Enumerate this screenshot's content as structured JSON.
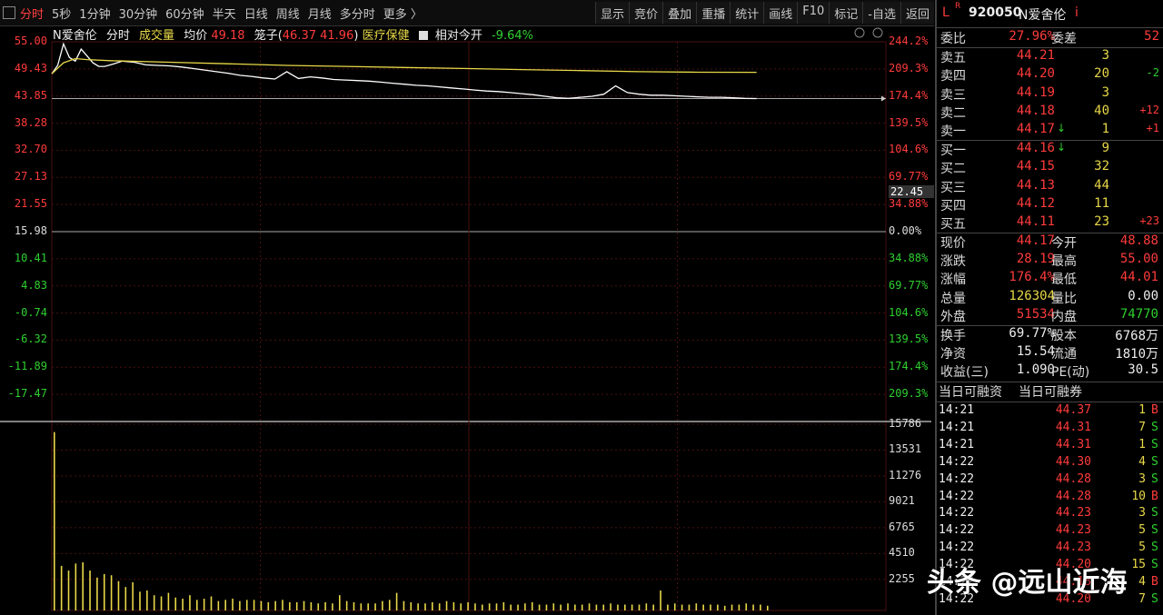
{
  "toolbar": {
    "periods": [
      "分时",
      "5秒",
      "1分钟",
      "30分钟",
      "60分钟",
      "半天",
      "日线",
      "周线",
      "月线",
      "多分时",
      "更多 〉"
    ],
    "right_buttons": [
      "显示",
      "竞价",
      "叠加",
      "重播",
      "统计",
      "画线",
      "F10",
      "标记",
      "-自选",
      "返回"
    ]
  },
  "chart_info": {
    "name": "N爱舍伦",
    "mode": "分时",
    "volume_label": "成交量",
    "avg_label": "均价",
    "avg_value": "49.18",
    "cage_label": "笼子(",
    "cage_range": "46.37 41.96",
    "cage_close": ")",
    "sector": "医疗保健",
    "relative_label": "相对今开",
    "relative_value": "-9.64%"
  },
  "price_axis": [
    "55.00",
    "49.43",
    "43.85",
    "38.28",
    "32.70",
    "27.13",
    "21.55",
    "15.98",
    "10.41",
    "4.83",
    "-0.74",
    "-6.32",
    "-11.89",
    "-17.47"
  ],
  "pct_axis": [
    "244.2%",
    "209.3%",
    "174.4%",
    "139.5%",
    "104.6%",
    "69.77%",
    "34.88%",
    "0.00%",
    "34.88%",
    "69.77%",
    "104.6%",
    "139.5%",
    "174.4%",
    "209.3%"
  ],
  "cursor_value": "22.45",
  "volume_axis": [
    "15786",
    "13531",
    "11276",
    "9021",
    "6765",
    "4510",
    "2255"
  ],
  "chart_data": {
    "type": "line",
    "title": "N爱舍伦 分时",
    "ylim": [
      -17.47,
      55.0
    ],
    "y_right_unit": "%",
    "prev_close": 15.98,
    "series": [
      {
        "name": "price",
        "color": "#ffffff",
        "x": [
          0,
          2,
          4,
          6,
          8,
          10,
          12,
          14,
          16,
          18,
          20,
          24,
          28,
          32,
          36,
          40,
          44,
          48,
          52,
          56,
          60,
          64,
          68,
          72,
          76,
          80,
          84,
          88,
          92,
          96,
          100,
          104,
          108,
          112,
          116,
          120,
          124,
          128,
          132,
          136,
          140,
          144,
          148,
          152,
          156,
          160,
          164,
          168,
          172,
          176,
          180,
          184,
          188,
          192,
          196,
          200,
          204,
          208,
          212,
          216,
          220,
          224,
          228,
          232,
          236,
          240
        ],
        "values": [
          48.9,
          50.5,
          54.6,
          52.0,
          51.3,
          53.6,
          52.3,
          51.0,
          50.3,
          50.3,
          50.6,
          51.3,
          51.1,
          50.6,
          50.5,
          50.4,
          50.2,
          49.9,
          49.6,
          49.3,
          49.0,
          48.6,
          48.4,
          48.1,
          47.9,
          49.3,
          48.0,
          48.3,
          48.1,
          47.8,
          47.7,
          47.6,
          47.5,
          47.3,
          47.1,
          46.9,
          46.7,
          46.6,
          46.4,
          46.2,
          46.0,
          45.8,
          45.6,
          45.5,
          45.3,
          45.1,
          44.9,
          44.6,
          44.3,
          44.2,
          44.4,
          44.6,
          45.0,
          46.6,
          45.3,
          45.0,
          44.8,
          44.8,
          44.7,
          44.6,
          44.5,
          44.4,
          44.4,
          44.3,
          44.2,
          44.17
        ]
      },
      {
        "name": "avg",
        "color": "#e8d848",
        "x": [
          0,
          4,
          8,
          12,
          20,
          40,
          60,
          80,
          100,
          120,
          140,
          160,
          180,
          200,
          220,
          240
        ],
        "values": [
          48.9,
          51.0,
          51.8,
          51.6,
          51.4,
          51.1,
          50.8,
          50.5,
          50.3,
          50.1,
          49.9,
          49.7,
          49.5,
          49.3,
          49.2,
          49.18
        ]
      }
    ],
    "volume": [
      15200,
      3800,
      3400,
      4000,
      4100,
      3400,
      2800,
      3100,
      3000,
      2500,
      2000,
      2400,
      1600,
      1700,
      1300,
      1200,
      1500,
      1100,
      1000,
      1300,
      900,
      1000,
      1200,
      800,
      900,
      1000,
      800,
      900,
      900,
      800,
      700,
      800,
      900,
      700,
      700,
      800,
      700,
      600,
      700,
      600,
      1300,
      800,
      700,
      600,
      600,
      600,
      800,
      900,
      1500,
      800,
      700,
      600,
      600,
      700,
      600,
      800,
      700,
      600,
      700,
      600,
      500,
      600,
      600,
      700,
      500,
      500,
      600,
      700,
      500,
      500,
      600,
      500,
      600,
      500,
      500,
      600,
      500,
      500,
      600,
      500,
      500,
      500,
      500,
      600,
      500,
      1700,
      500,
      600,
      500,
      500,
      600,
      500,
      500,
      500,
      400,
      500,
      500,
      600,
      500,
      500,
      400
    ]
  },
  "panel": {
    "header": {
      "l": "L",
      "r": "R",
      "code": "920050",
      "name": "N爱舍伦",
      "i": "i"
    },
    "weibi": {
      "label1": "委比",
      "value1": "27.96%",
      "label2": "委差",
      "value2": "52"
    },
    "asks": [
      {
        "label": "卖五",
        "price": "44.21",
        "vol": "3",
        "chg": ""
      },
      {
        "label": "卖四",
        "price": "44.20",
        "vol": "20",
        "chg": "-2"
      },
      {
        "label": "卖三",
        "price": "44.19",
        "vol": "3",
        "chg": ""
      },
      {
        "label": "卖二",
        "price": "44.18",
        "vol": "40",
        "chg": "+12"
      },
      {
        "label": "卖一",
        "price": "44.17",
        "vol": "1",
        "chg": "+1"
      }
    ],
    "bids": [
      {
        "label": "买一",
        "price": "44.16",
        "vol": "9",
        "chg": ""
      },
      {
        "label": "买二",
        "price": "44.15",
        "vol": "32",
        "chg": ""
      },
      {
        "label": "买三",
        "price": "44.13",
        "vol": "44",
        "chg": ""
      },
      {
        "label": "买四",
        "price": "44.12",
        "vol": "11",
        "chg": ""
      },
      {
        "label": "买五",
        "price": "44.11",
        "vol": "23",
        "chg": "+23"
      }
    ],
    "stats": [
      {
        "l1": "现价",
        "v1": "44.17",
        "l2": "今开",
        "v2": "48.88",
        "c1": "red",
        "c2": "red"
      },
      {
        "l1": "涨跌",
        "v1": "28.19",
        "l2": "最高",
        "v2": "55.00",
        "c1": "red",
        "c2": "red"
      },
      {
        "l1": "涨幅",
        "v1": "176.4%",
        "l2": "最低",
        "v2": "44.01",
        "c1": "red",
        "c2": "red"
      },
      {
        "l1": "总量",
        "v1": "126304",
        "l2": "量比",
        "v2": "0.00",
        "c1": "yellow",
        "c2": "white"
      },
      {
        "l1": "外盘",
        "v1": "51534",
        "l2": "内盘",
        "v2": "74770",
        "c1": "red",
        "c2": "green"
      }
    ],
    "stats2": [
      {
        "l1": "换手",
        "v1": "69.77%",
        "l2": "股本",
        "v2": "6768万"
      },
      {
        "l1": "净资",
        "v1": "15.54",
        "l2": "流通",
        "v2": "1810万"
      },
      {
        "l1": "收益(三)",
        "v1": "1.090",
        "l2": "PE(动)",
        "v2": "30.5"
      }
    ],
    "margin": {
      "a": "当日可融资",
      "b": "当日可融券"
    },
    "trades": [
      {
        "t": "14:21",
        "p": "44.37",
        "v": "1",
        "s": "B"
      },
      {
        "t": "14:21",
        "p": "44.31",
        "v": "7",
        "s": "S"
      },
      {
        "t": "14:21",
        "p": "44.31",
        "v": "1",
        "s": "S"
      },
      {
        "t": "14:22",
        "p": "44.30",
        "v": "4",
        "s": "S"
      },
      {
        "t": "14:22",
        "p": "44.28",
        "v": "3",
        "s": "S"
      },
      {
        "t": "14:22",
        "p": "44.28",
        "v": "10",
        "s": "B"
      },
      {
        "t": "14:22",
        "p": "44.23",
        "v": "3",
        "s": "S"
      },
      {
        "t": "14:22",
        "p": "44.23",
        "v": "5",
        "s": "S"
      },
      {
        "t": "14:22",
        "p": "44.23",
        "v": "5",
        "s": "S"
      },
      {
        "t": "14:22",
        "p": "44.20",
        "v": "15",
        "s": "S"
      },
      {
        "t": "14:22",
        "p": "44.18",
        "v": "4",
        "s": "B"
      },
      {
        "t": "14:22",
        "p": "44.20",
        "v": "7",
        "s": "S"
      }
    ]
  },
  "watermark": "头条 @远山近海",
  "colors": {
    "up": "#ff3b3b",
    "down": "#2fd02f",
    "price_line": "#ffffff",
    "avg_line": "#e8d848",
    "grid": "#4a1010"
  }
}
